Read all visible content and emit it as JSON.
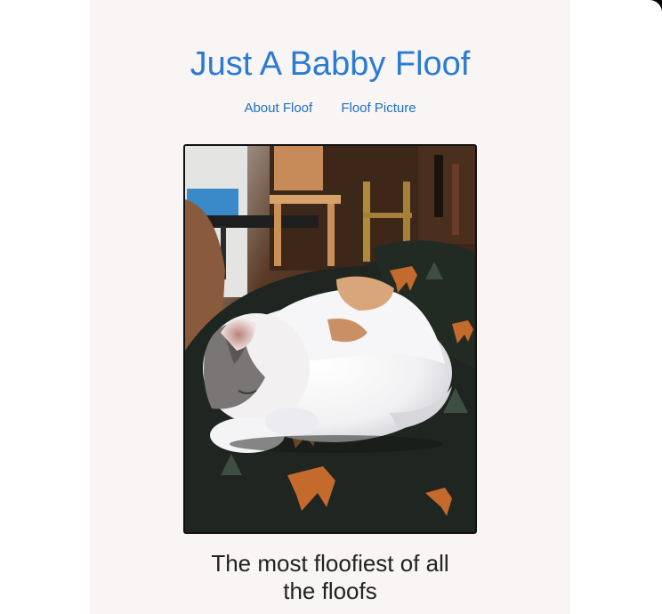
{
  "site": {
    "title": "Just A Babby Floof"
  },
  "nav": {
    "items": [
      {
        "label": "About Floof"
      },
      {
        "label": "Floof Picture"
      }
    ]
  },
  "photo": {
    "alt": "calico kitten sleeping curled up on a dark blanket"
  },
  "caption": {
    "line1": "The most floofiest of all",
    "line2": "the floofs"
  },
  "colors": {
    "title": "#2a7bd3",
    "nav_link": "#1f6fc4",
    "page_background": "#f8f5f4",
    "caption_text": "#222222"
  }
}
